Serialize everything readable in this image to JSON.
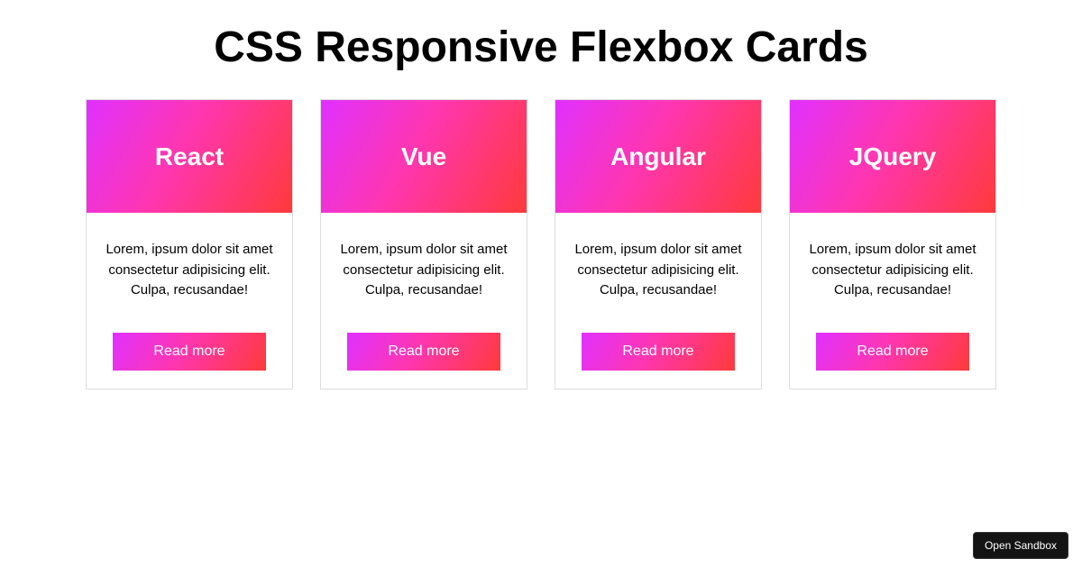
{
  "page": {
    "title": "CSS Responsive Flexbox Cards"
  },
  "cards": [
    {
      "title": "React",
      "text": "Lorem, ipsum dolor sit amet consectetur adipisicing elit. Culpa, recusandae!",
      "button": "Read more"
    },
    {
      "title": "Vue",
      "text": "Lorem, ipsum dolor sit amet consectetur adipisicing elit. Culpa, recusandae!",
      "button": "Read more"
    },
    {
      "title": "Angular",
      "text": "Lorem, ipsum dolor sit amet consectetur adipisicing elit. Culpa, recusandae!",
      "button": "Read more"
    },
    {
      "title": "JQuery",
      "text": "Lorem, ipsum dolor sit amet consectetur adipisicing elit. Culpa, recusandae!",
      "button": "Read more"
    }
  ],
  "sandbox": {
    "label": "Open Sandbox"
  },
  "colors": {
    "gradient_start": "#e030ff",
    "gradient_mid": "#ff36b0",
    "gradient_end": "#ff3a3a"
  }
}
